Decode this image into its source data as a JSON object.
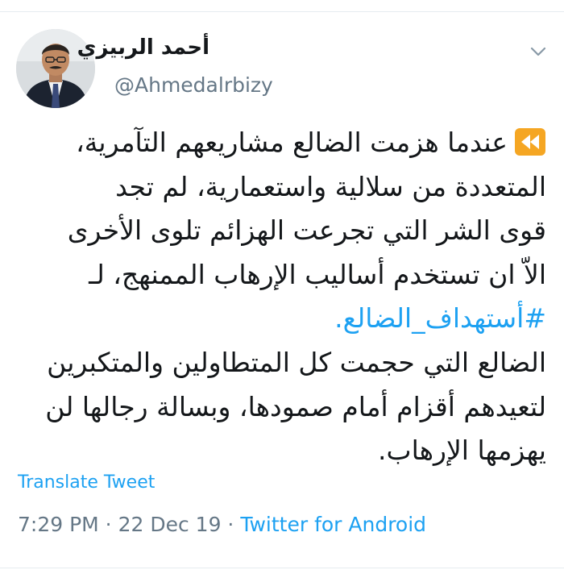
{
  "tweet": {
    "author": {
      "display_name": "أحمد الربيزي",
      "handle": "@Ahmedalrbizy",
      "avatar_icon": "user-photo-avatar"
    },
    "menu_icon": "chevron-down-icon",
    "rewind_icon": "rewind-emoji-icon",
    "text_lines": [
      "عندما هزمت الضالع مشاريعهم التآمرية،",
      "المتعددة من سلالية واستعمارية، لم تجد",
      "قوى الشر  التي تجرعت الهزائم تلوى الأخرى",
      "الاّ ان تستخدم أساليب الإرهاب الممنهج، لـ",
      "#أستهداف_الضالع.",
      "الضالع التي حجمت كل المتطاولين والمتكبرين",
      "لتعيدهم أقزام أمام صمودها، وبسالة رجالها لن",
      "يهزمها الإرهاب."
    ],
    "hashtag": "#أستهداف_الضالع",
    "translate_label": "Translate Tweet",
    "time": "7:29 PM",
    "separator": " · ",
    "date": "22 Dec 19",
    "source": "Twitter for Android"
  },
  "colors": {
    "link": "#1da1f2",
    "secondary_text": "#657786",
    "primary_text": "#14171a",
    "rewind_orange": "#f5a623"
  }
}
